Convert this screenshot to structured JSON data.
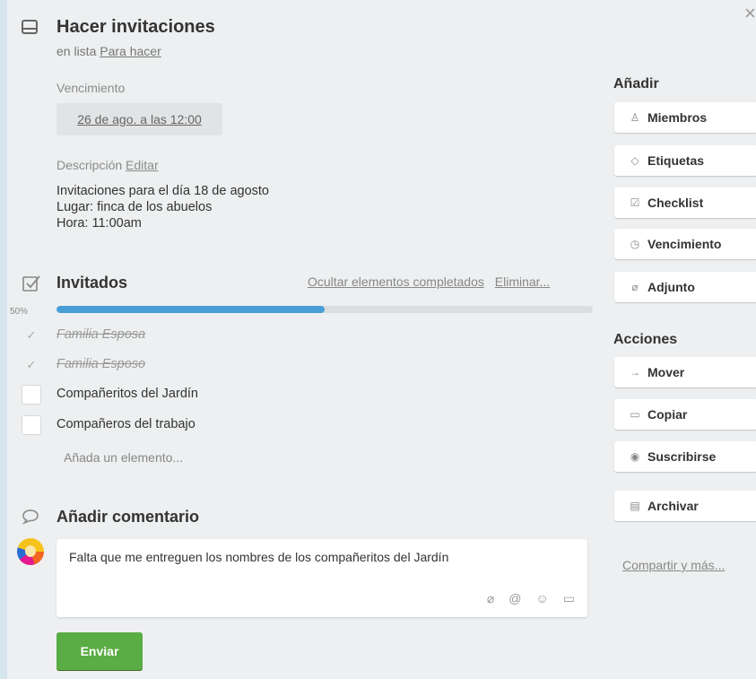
{
  "card": {
    "title": "Hacer invitaciones",
    "in_list_prefix": "en lista",
    "list_name": "Para hacer",
    "close_icon": "×"
  },
  "due": {
    "label": "Vencimiento",
    "value": "26 de ago. a las 12:00"
  },
  "description": {
    "label": "Descripción",
    "edit_label": "Editar",
    "text": "Invitaciones para el día 18 de agosto\nLugar: finca de los abuelos\nHora: 11:00am"
  },
  "checklist": {
    "title": "Invitados",
    "hide_completed_label": "Ocultar elementos completados",
    "delete_label": "Eliminar...",
    "progress_label": "50%",
    "progress": 0.5,
    "items": [
      {
        "text": "Familia Esposa",
        "done": true
      },
      {
        "text": "Familia Esposo",
        "done": true
      },
      {
        "text": "Compañeritos del Jardín",
        "done": false
      },
      {
        "text": "Compañeros del trabajo",
        "done": false
      }
    ],
    "add_item_placeholder": "Añada un elemento..."
  },
  "comment": {
    "title": "Añadir comentario",
    "text": "Falta que me entreguen los nombres de los compañeritos del Jardín",
    "send_label": "Enviar"
  },
  "sidebar": {
    "add_heading": "Añadir",
    "add_buttons": [
      {
        "label": "Miembros",
        "icon": "person-icon",
        "glyph": "♙"
      },
      {
        "label": "Etiquetas",
        "icon": "label-icon",
        "glyph": "◇"
      },
      {
        "label": "Checklist",
        "icon": "checklist-icon",
        "glyph": "☑"
      },
      {
        "label": "Vencimiento",
        "icon": "clock-icon",
        "glyph": "◷"
      },
      {
        "label": "Adjunto",
        "icon": "paperclip-icon",
        "glyph": "⌀"
      }
    ],
    "actions_heading": "Acciones",
    "action_buttons": [
      {
        "label": "Mover",
        "icon": "arrow-right-icon",
        "glyph": "→"
      },
      {
        "label": "Copiar",
        "icon": "card-icon",
        "glyph": "▭"
      },
      {
        "label": "Suscribirse",
        "icon": "eye-icon",
        "glyph": "◉"
      },
      {
        "label": "Archivar",
        "icon": "archive-icon",
        "glyph": "▤"
      }
    ],
    "share_label": "Compartir y más..."
  },
  "colors": {
    "accent_blue": "#4a9ed6",
    "send_green": "#5aac44",
    "background": "#edeff0"
  }
}
